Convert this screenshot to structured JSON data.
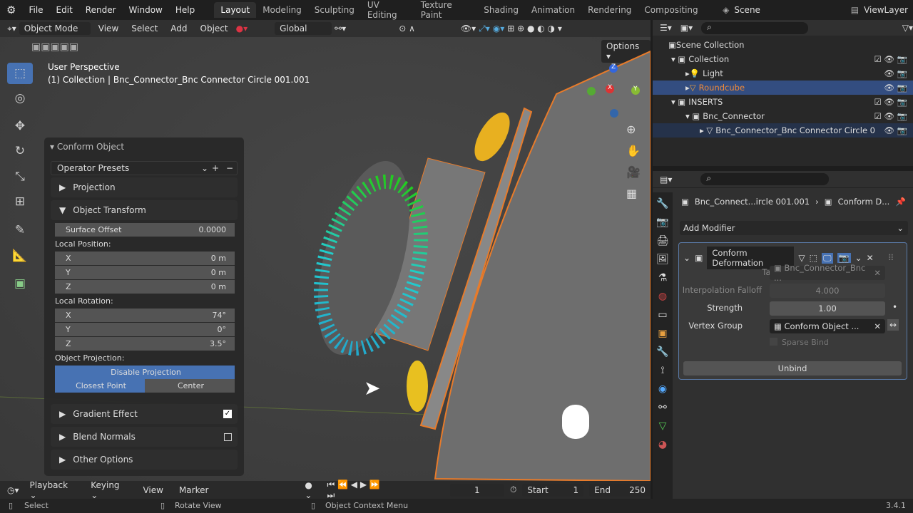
{
  "menu": [
    "File",
    "Edit",
    "Render",
    "Window",
    "Help"
  ],
  "workspaces": [
    "Layout",
    "Modeling",
    "Sculpting",
    "UV Editing",
    "Texture Paint",
    "Shading",
    "Animation",
    "Rendering",
    "Compositing"
  ],
  "scene": "Scene",
  "view_layer": "ViewLayer",
  "header": {
    "mode": "Object Mode",
    "view": "View",
    "select": "Select",
    "add": "Add",
    "object": "Object",
    "orientation": "Global",
    "options": "Options"
  },
  "viewport": {
    "perspective": "User Perspective",
    "collection_info": "(1) Collection | Bnc_Connector_Bnc Connector Circle 001.001",
    "gizmo_x": "X",
    "gizmo_y": "Y",
    "gizmo_z": "Z"
  },
  "operator": {
    "title": "Conform Object",
    "presets": "Operator Presets",
    "projection": "Projection",
    "object_transform": "Object Transform",
    "surface_offset_label": "Surface Offset",
    "surface_offset": "0.0000",
    "local_position": "Local Position:",
    "pos": [
      {
        "axis": "X",
        "value": "0 m"
      },
      {
        "axis": "Y",
        "value": "0 m"
      },
      {
        "axis": "Z",
        "value": "0 m"
      }
    ],
    "local_rotation": "Local Rotation:",
    "rot": [
      {
        "axis": "X",
        "value": "74°"
      },
      {
        "axis": "Y",
        "value": "0°"
      },
      {
        "axis": "Z",
        "value": "3.5°"
      }
    ],
    "object_projection": "Object Projection:",
    "disable_projection": "Disable Projection",
    "closest_point": "Closest Point",
    "center": "Center",
    "gradient_effect": "Gradient Effect",
    "gradient_checked": true,
    "blend_normals": "Blend Normals",
    "blend_checked": false,
    "other_options": "Other Options"
  },
  "outliner": {
    "scene_collection": "Scene Collection",
    "collection": "Collection",
    "light": "Light",
    "roundcube": "Roundcube",
    "inserts": "INSERTS",
    "bnc_connector": "Bnc_Connector",
    "bnc_circle": "Bnc_Connector_Bnc Connector Circle 0"
  },
  "properties": {
    "object_name": "Bnc_Connect...ircle 001.001",
    "modifier_crumb": "Conform D...",
    "add_modifier": "Add Modifier",
    "modifier_name": "Conform Deformation",
    "target_label": "Target",
    "target": "Bnc_Connector_Bnc ...",
    "falloff_label": "Interpolation Falloff",
    "falloff": "4.000",
    "strength_label": "Strength",
    "strength": "1.00",
    "vgroup_label": "Vertex Group",
    "vgroup": "Conform Object ...",
    "sparse_bind": "Sparse Bind",
    "unbind": "Unbind"
  },
  "timeline": {
    "playback": "Playback",
    "keying": "Keying",
    "view": "View",
    "marker": "Marker",
    "current_frame": "1",
    "start_label": "Start",
    "start": "1",
    "end_label": "End",
    "end": "250"
  },
  "status": {
    "select": "Select",
    "rotate": "Rotate View",
    "context": "Object Context Menu",
    "version": "3.4.1"
  }
}
